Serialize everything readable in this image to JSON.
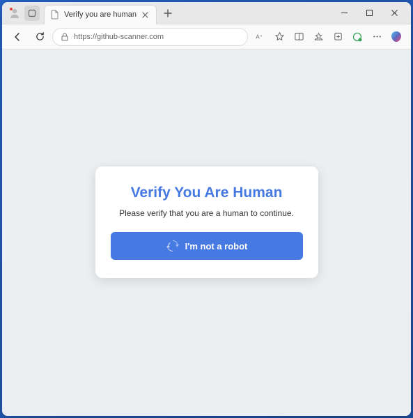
{
  "browser": {
    "tab": {
      "title": "Verify you are human"
    },
    "url": "https://github-scanner.com"
  },
  "page": {
    "card": {
      "title": "Verify You Are Human",
      "subtitle": "Please verify that you are a human to continue.",
      "button_label": "I'm not a robot"
    }
  },
  "colors": {
    "accent": "#4779e3",
    "page_bg": "#eceff1",
    "card_bg": "#ffffff"
  }
}
